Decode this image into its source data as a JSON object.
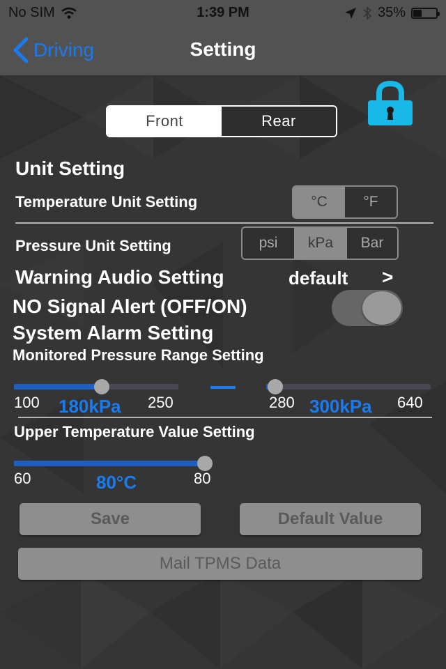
{
  "status_bar": {
    "carrier": "No SIM",
    "time": "1:39 PM",
    "battery_percent": "35%",
    "battery_level": 0.35,
    "icons": [
      "wifi-icon",
      "location-arrow-icon",
      "bluetooth-icon",
      "battery-icon"
    ]
  },
  "nav": {
    "back_label": "Driving",
    "title": "Setting"
  },
  "axle_selector": {
    "options": [
      "Front",
      "Rear"
    ],
    "selected": "Front"
  },
  "lock_icon": "lock-icon",
  "unit_setting": {
    "heading": "Unit Setting",
    "temperature": {
      "label": "Temperature Unit Setting",
      "options": [
        "°C",
        "°F"
      ],
      "selected": "°C"
    },
    "pressure": {
      "label": "Pressure Unit Setting",
      "options": [
        "psi",
        "kPa",
        "Bar"
      ],
      "selected": "kPa"
    }
  },
  "warning_audio": {
    "label": "Warning Audio Setting",
    "value": "default",
    "chevron": ">"
  },
  "no_signal_alert": {
    "label": "NO Signal Alert (OFF/ON)",
    "on": true
  },
  "system_alarm": {
    "heading": "System Alarm Setting",
    "pressure_range": {
      "label": "Monitored Pressure Range Setting",
      "low": {
        "min": "100",
        "max": "250",
        "value": 180,
        "value_label": "180kPa"
      },
      "high": {
        "min": "280",
        "max": "640",
        "value": 300,
        "value_label": "300kPa"
      }
    },
    "upper_temp": {
      "label": "Upper Temperature Value Setting",
      "min": "60",
      "max": "80",
      "value": 80,
      "value_label": "80°C"
    }
  },
  "buttons": {
    "save": "Save",
    "default_value": "Default Value",
    "mail": "Mail TPMS Data"
  },
  "colors": {
    "accent": "#1a7bf0",
    "lock": "#18b8e8",
    "slider_fill": "#1f5fbf"
  }
}
